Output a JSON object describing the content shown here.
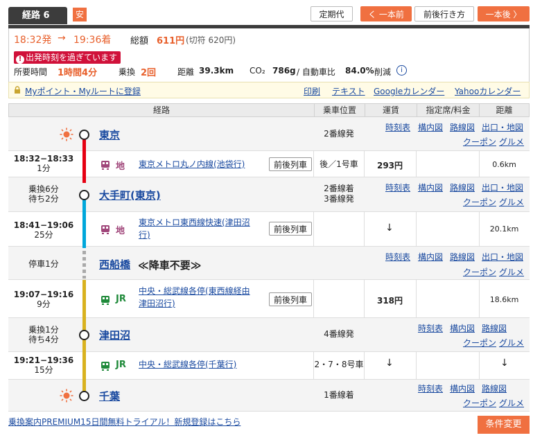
{
  "header": {
    "route_tab": "経路 6",
    "safe_badge": "安",
    "buttons": {
      "teiki": "定期代",
      "prev": "く 一本前",
      "around": "前後行き方",
      "next": "一本後 〉"
    }
  },
  "summary": {
    "dep_time": "18:32発",
    "arrow": "→",
    "arr_time": "19:36着",
    "total_label": "総額",
    "total_value": "611円",
    "ticket_note": "(切符 620円)",
    "warning": "出発時刻を過ぎています",
    "duration_label": "所要時間",
    "duration_value": "1時間4分",
    "transfer_label": "乗換",
    "transfer_value": "2回",
    "distance_label": "距離",
    "distance_value": "39.3km",
    "co2_label": "CO₂",
    "co2_value": "786g",
    "co2_sep": "/ 自動車比",
    "co2_ratio": "84.0%",
    "co2_suffix": "削減"
  },
  "linkbar": {
    "myroute": "Myポイント・Myルートに登録",
    "print": "印刷",
    "text": "テキスト",
    "google": "Googleカレンダー",
    "yahoo": "Yahooカレンダー"
  },
  "table_headers": {
    "route": "経路",
    "position": "乗車位置",
    "fare": "運賃",
    "reserved": "指定席/料金",
    "distance": "距離"
  },
  "station_links": {
    "timetable": "時刻表",
    "map_in": "構内図",
    "line_map": "路線図",
    "exit_map": "出口・地図",
    "coupon": "クーポン",
    "gourmet": "グルメ"
  },
  "stations": [
    {
      "name": "東京",
      "platform": "2番線発"
    },
    {
      "name": "大手町(東京)",
      "time1": "乗換6分",
      "time2": "待ち2分",
      "platform1": "2番線着",
      "platform2": "3番線発"
    },
    {
      "name": "西船橋",
      "note": "≪降車不要≫",
      "time1": "停車1分"
    },
    {
      "name": "津田沼",
      "time1": "乗換1分",
      "time2": "待ち4分",
      "platform": "4番線発"
    },
    {
      "name": "千葉",
      "platform": "1番線着"
    }
  ],
  "segments": [
    {
      "time": "18:32−18:33",
      "dur": "1分",
      "kind": "地",
      "line": "東京メトロ丸ノ内線(池袋行)",
      "button": "前後列車",
      "position": "後／1号車",
      "fare": "293円",
      "distance": "0.6km",
      "color": "#e60012"
    },
    {
      "time": "18:41−19:06",
      "dur": "25分",
      "kind": "地",
      "line1": "東京メトロ東西線快速(津田沼",
      "line2": "行)",
      "button": "前後列車",
      "fare_arrow": "↓",
      "distance": "20.1km",
      "color": "#00a7db"
    },
    {
      "time": "19:07−19:16",
      "dur": "9分",
      "kind": "JR",
      "line1": "中央・総武線各停(東西線経由",
      "line2": "津田沼行)",
      "button": "前後列車",
      "fare": "318円",
      "distance": "18.6km",
      "color": "#d9b21f"
    },
    {
      "time": "19:21−19:36",
      "dur": "15分",
      "kind": "JR",
      "line": "中央・総武線各停(千葉行)",
      "position": "2・7・8号車",
      "fare_arrow": "↓",
      "distance_arrow": "↓",
      "color": "#d9b21f"
    }
  ],
  "footer": {
    "premium": "乗換案内PREMIUM15日間無料トライアル！新規登録はこちら",
    "change": "条件変更"
  }
}
